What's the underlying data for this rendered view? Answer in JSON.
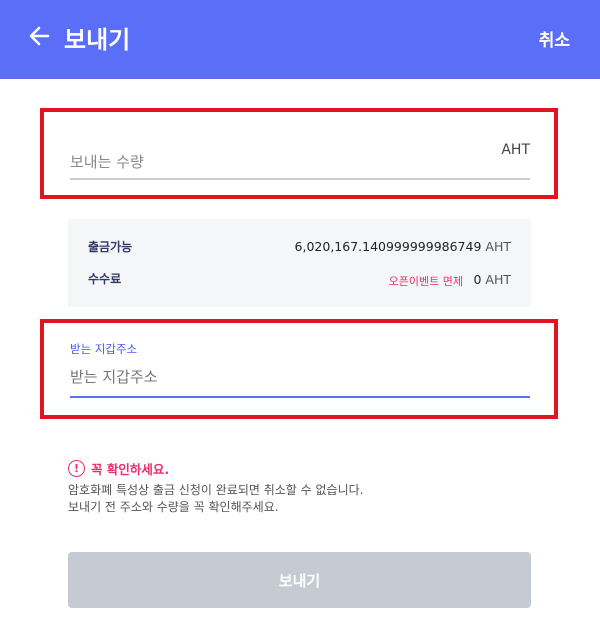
{
  "header": {
    "title": "보내기",
    "cancel_label": "취소",
    "back_icon": "arrow-left-icon",
    "color": "#5b6ef8"
  },
  "amount": {
    "placeholder": "보내는 수량",
    "value": "",
    "unit": "AHT"
  },
  "info": {
    "available_label": "출금가능",
    "available_value": "6,020,167.140999999986749",
    "available_unit": "AHT",
    "fee_label": "수수료",
    "fee_event": "오픈이벤트 면제",
    "fee_value": "0",
    "fee_unit": "AHT"
  },
  "address": {
    "label": "받는 지갑주소",
    "placeholder": "받는 지갑주소",
    "value": ""
  },
  "notice": {
    "icon": "exclamation-circle-icon",
    "title": "꼭 확인하세요.",
    "line1": "암호화폐 특성상 출금 신청이 완료되면 취소할 수 없습니다.",
    "line2": "보내기 전 주소와 수량을 꼭 확인해주세요."
  },
  "submit": {
    "label": "보내기",
    "enabled": false
  },
  "highlight_color": "#e0161f",
  "accent_color": "#e8316a"
}
